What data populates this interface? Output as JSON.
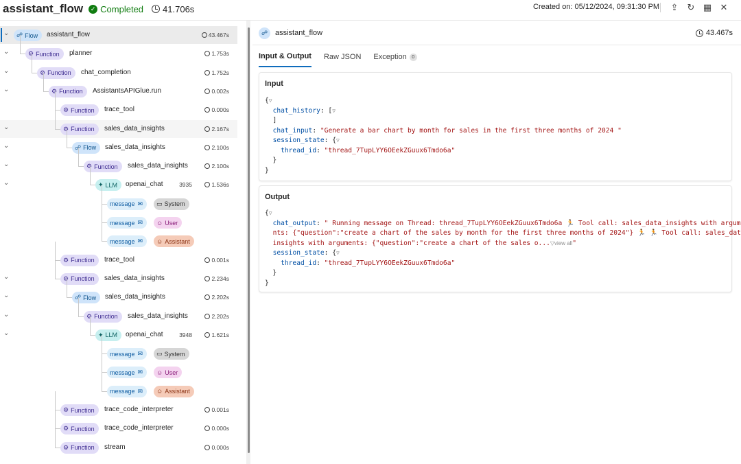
{
  "header": {
    "app_title": "assistant_flow",
    "status": "Completed",
    "duration": "41.706s",
    "created": "Created on: 05/12/2024, 09:31:30 PM"
  },
  "tree": [
    {
      "type": "Flow",
      "name": "assistant_flow",
      "duration": "43.467s",
      "depth": 0,
      "expanded": true
    },
    {
      "type": "Function",
      "name": "planner",
      "duration": "1.753s",
      "depth": 1,
      "expanded": true
    },
    {
      "type": "Function",
      "name": "chat_completion",
      "duration": "1.752s",
      "depth": 2,
      "expanded": true
    },
    {
      "type": "Function",
      "name": "AssistantsAPIGlue.run",
      "duration": "0.002s",
      "depth": 3,
      "expanded": true
    },
    {
      "type": "Function",
      "name": "trace_tool",
      "duration": "0.000s",
      "depth": 4,
      "expanded": false
    },
    {
      "type": "Function",
      "name": "sales_data_insights",
      "duration": "2.167s",
      "depth": 4,
      "expanded": true
    },
    {
      "type": "Flow",
      "name": "sales_data_insights",
      "duration": "2.100s",
      "depth": 5,
      "expanded": true
    },
    {
      "type": "Function",
      "name": "sales_data_insights",
      "duration": "2.100s",
      "depth": 6,
      "expanded": true
    },
    {
      "type": "LLM",
      "name": "openai_chat",
      "duration": "1.536s",
      "tokens": "3935",
      "depth": 7,
      "expanded": true
    },
    {
      "type": "message",
      "role": "System",
      "depth": 8
    },
    {
      "type": "message",
      "role": "User",
      "depth": 8
    },
    {
      "type": "message",
      "role": "Assistant",
      "depth": 8
    },
    {
      "type": "Function",
      "name": "trace_tool",
      "duration": "0.001s",
      "depth": 4,
      "expanded": false
    },
    {
      "type": "Function",
      "name": "sales_data_insights",
      "duration": "2.234s",
      "depth": 4,
      "expanded": true
    },
    {
      "type": "Flow",
      "name": "sales_data_insights",
      "duration": "2.202s",
      "depth": 5,
      "expanded": true
    },
    {
      "type": "Function",
      "name": "sales_data_insights",
      "duration": "2.202s",
      "depth": 6,
      "expanded": true
    },
    {
      "type": "LLM",
      "name": "openai_chat",
      "duration": "1.621s",
      "tokens": "3948",
      "depth": 7,
      "expanded": true
    },
    {
      "type": "message",
      "role": "System",
      "depth": 8
    },
    {
      "type": "message",
      "role": "User",
      "depth": 8
    },
    {
      "type": "message",
      "role": "Assistant",
      "depth": 8
    },
    {
      "type": "Function",
      "name": "trace_code_interpreter",
      "duration": "0.001s",
      "depth": 4,
      "expanded": false
    },
    {
      "type": "Function",
      "name": "trace_code_interpreter",
      "duration": "0.000s",
      "depth": 4,
      "expanded": false
    },
    {
      "type": "Function",
      "name": "stream",
      "duration": "0.000s",
      "depth": 4,
      "expanded": false
    }
  ],
  "detail": {
    "title": "assistant_flow",
    "duration": "43.467s",
    "tabs": [
      {
        "label": "Input & Output",
        "active": true
      },
      {
        "label": "Raw JSON",
        "active": false
      },
      {
        "label": "Exception",
        "active": false,
        "count": "0"
      }
    ],
    "input": {
      "title": "Input",
      "chat_history_key": "chat_history",
      "chat_input_key": "chat_input",
      "chat_input": "\"Generate a bar chart by month for sales in the first three months of 2024 \"",
      "session_state_key": "session_state",
      "thread_id_key": "thread_id",
      "thread_id": "\"thread_7TupLYY6OEekZGuux6Tmdo6a\""
    },
    "output": {
      "title": "Output",
      "chat_output_key": "chat_output",
      "chat_output_line1": "\" Running message on Thread: thread_7TupLYY6OEekZGuux6Tmdo6a 🏃 Tool call: sales_data_insights with argume",
      "chat_output_line2": "nts: {\"question\":\"create a chart of the sales by month for the first three months of 2024\"} 🏃 🏃 Tool call: sales_data_",
      "chat_output_line3": "insights with arguments: {\"question\":\"create a chart of the sales o...",
      "view_all": "view all",
      "chat_output_end": "\"",
      "session_state_key": "session_state",
      "thread_id_key": "thread_id",
      "thread_id": "\"thread_7TupLYY6OEekZGuux6Tmdo6a\""
    }
  }
}
